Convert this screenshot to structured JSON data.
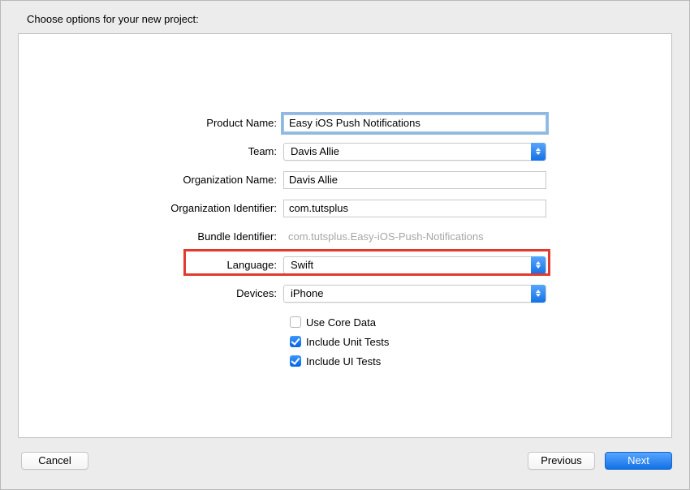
{
  "header": {
    "title": "Choose options for your new project:"
  },
  "form": {
    "product_name_label": "Product Name:",
    "product_name_value": "Easy iOS Push Notifications",
    "team_label": "Team:",
    "team_value": "Davis Allie",
    "org_name_label": "Organization Name:",
    "org_name_value": "Davis Allie",
    "org_id_label": "Organization Identifier:",
    "org_id_value": "com.tutsplus",
    "bundle_id_label": "Bundle Identifier:",
    "bundle_id_value": "com.tutsplus.Easy-iOS-Push-Notifications",
    "language_label": "Language:",
    "language_value": "Swift",
    "devices_label": "Devices:",
    "devices_value": "iPhone"
  },
  "checkboxes": {
    "core_data": {
      "label": "Use Core Data",
      "checked": false
    },
    "unit_tests": {
      "label": "Include Unit Tests",
      "checked": true
    },
    "ui_tests": {
      "label": "Include UI Tests",
      "checked": true
    }
  },
  "buttons": {
    "cancel": "Cancel",
    "previous": "Previous",
    "next": "Next"
  }
}
